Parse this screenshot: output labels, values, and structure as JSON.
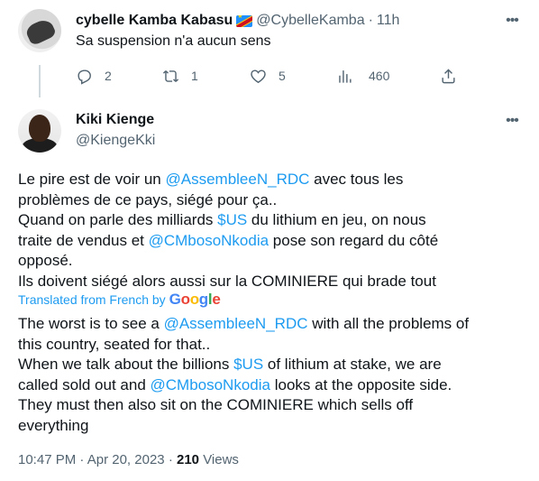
{
  "reply": {
    "name": "cybelle Kamba Kabasu",
    "handle": "@CybelleKamba",
    "time": "11h",
    "text": "Sa suspension n'a aucun sens",
    "counts": {
      "replies": "2",
      "retweets": "1",
      "likes": "5",
      "views": "460"
    }
  },
  "tweet": {
    "name": "Kiki Kienge",
    "handle": "@KiengeKki",
    "original_lines": [
      [
        {
          "t": "Le pire est de voir un "
        },
        {
          "t": "@AssembleeN_RDC",
          "link": true
        },
        {
          "t": " avec tous les"
        }
      ],
      [
        {
          "t": "problèmes de ce pays, siégé pour ça.."
        }
      ],
      [
        {
          "t": "Quand on parle des milliards "
        },
        {
          "t": "$US",
          "link": true
        },
        {
          "t": " du lithium en jeu, on nous"
        }
      ],
      [
        {
          "t": "traite de vendus et "
        },
        {
          "t": "@CMbosoNkodia",
          "link": true
        },
        {
          "t": " pose son regard du côté"
        }
      ],
      [
        {
          "t": "opposé."
        }
      ],
      [
        {
          "t": "Ils doivent siégé alors aussi sur la COMINIERE qui brade tout"
        }
      ]
    ],
    "translated_label": "Translated from French by",
    "translator": "Google",
    "translated_lines": [
      [
        {
          "t": "The worst is to see a "
        },
        {
          "t": "@AssembleeN_RDC",
          "link": true
        },
        {
          "t": " with all the problems of"
        }
      ],
      [
        {
          "t": "this country, seated for that.."
        }
      ],
      [
        {
          "t": "When we talk about the billions "
        },
        {
          "t": "$US",
          "link": true
        },
        {
          "t": " of lithium at stake, we are"
        }
      ],
      [
        {
          "t": "called sold out and "
        },
        {
          "t": "@CMbosoNkodia",
          "link": true
        },
        {
          "t": " looks at the opposite side."
        }
      ],
      [
        {
          "t": "They must then also sit on the COMINIERE which sells off"
        }
      ],
      [
        {
          "t": "everything"
        }
      ]
    ],
    "time": "10:47 PM",
    "date": "Apr 20, 2023",
    "views_count": "210",
    "views_label": "Views"
  },
  "colors": {
    "link": "#1d9bf0",
    "muted": "#536471",
    "text": "#0f1419"
  },
  "icons": [
    "reply-icon",
    "retweet-icon",
    "like-icon",
    "views-icon",
    "share-icon",
    "more-icon",
    "flag-icon"
  ]
}
